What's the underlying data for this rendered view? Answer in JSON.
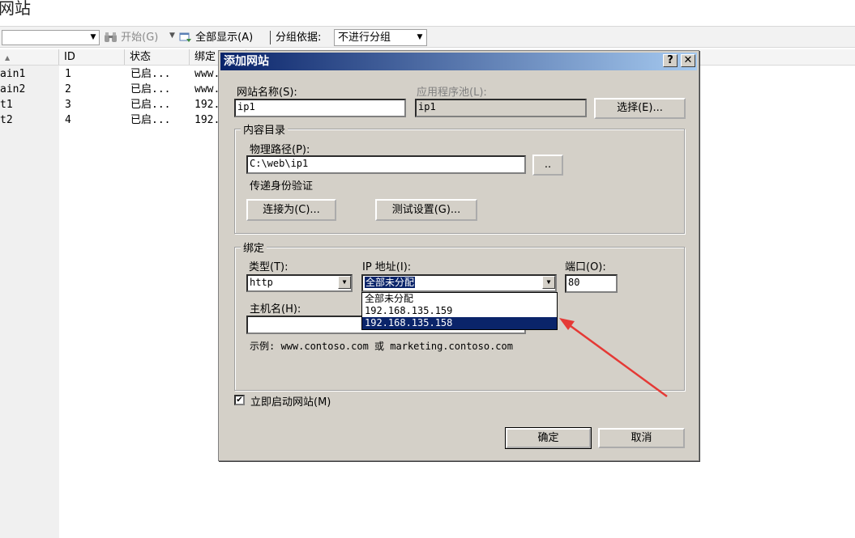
{
  "page": {
    "title": "网站"
  },
  "toolbar": {
    "start_label": "开始(G)",
    "show_all_label": "全部显示(A)",
    "group_by_label": "分组依据:",
    "group_by_value": "不进行分组",
    "icons": {
      "start": "binoculars-icon",
      "show_all": "show-all-icon"
    }
  },
  "list": {
    "columns": [
      "ID",
      "状态",
      "绑定"
    ],
    "rows": [
      {
        "name": "ain1",
        "id": "1",
        "status": "已启...",
        "binding": "www."
      },
      {
        "name": "ain2",
        "id": "2",
        "status": "已启...",
        "binding": "www."
      },
      {
        "name": "t1",
        "id": "3",
        "status": "已启...",
        "binding": "192."
      },
      {
        "name": "t2",
        "id": "4",
        "status": "已启...",
        "binding": "192."
      }
    ]
  },
  "dialog": {
    "title": "添加网站",
    "help_button": "?",
    "close_button": "✕",
    "site_name_label": "网站名称(S):",
    "site_name_value": "ip1",
    "app_pool_label": "应用程序池(L):",
    "app_pool_value": "ip1",
    "select_button": "选择(E)...",
    "content": {
      "group_title": "内容目录",
      "physical_path_label": "物理路径(P):",
      "physical_path_value": "C:\\web\\ip1",
      "browse_button": "..",
      "pass_auth_label": "传递身份验证",
      "connect_as_button": "连接为(C)...",
      "test_settings_button": "测试设置(G)..."
    },
    "binding": {
      "group_title": "绑定",
      "type_label": "类型(T):",
      "type_value": "http",
      "ip_label": "IP 地址(I):",
      "ip_value": "全部未分配",
      "ip_options": [
        "全部未分配",
        "192.168.135.159",
        "192.168.135.158"
      ],
      "ip_selected_index": 2,
      "port_label": "端口(O):",
      "port_value": "80",
      "host_label": "主机名(H):",
      "host_value": "",
      "example_text": "示例: www.contoso.com 或 marketing.contoso.com"
    },
    "start_immediately_label": "立即启动网站(M)",
    "start_immediately_checked": true,
    "ok_button": "确定",
    "cancel_button": "取消"
  },
  "annotation": {
    "arrow_color": "#e53935"
  },
  "colors": {
    "titlebar": "#0a246a",
    "selection": "#0a246a",
    "dialog_bg": "#d4d0c8"
  }
}
